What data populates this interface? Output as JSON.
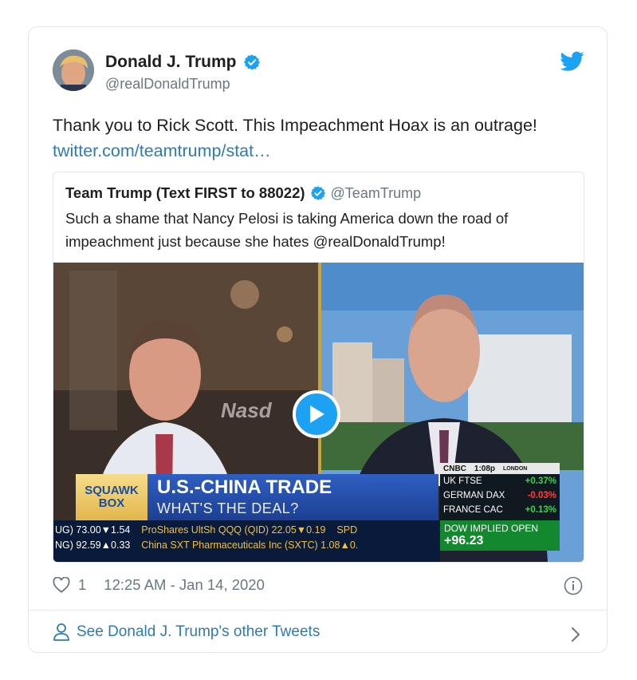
{
  "author": {
    "name": "Donald J. Trump",
    "handle": "@realDonaldTrump"
  },
  "tweet": {
    "text": "Thank you to Rick Scott. This Impeachment Hoax is an outrage!",
    "link": "twitter.com/teamtrump/stat…"
  },
  "quoted": {
    "name": "Team Trump (Text FIRST to 88022)",
    "handle": "@TeamTrump",
    "text": "Such a shame that Nancy Pelosi is taking America down the road of impeachment just because she hates @realDonaldTrump!"
  },
  "video": {
    "watermark": "Nasd",
    "show_line1": "SQUAWK",
    "show_line2": "BOX",
    "headline": "U.S.-CHINA TRADE",
    "subheadline": "WHAT'S THE DEAL?",
    "network": "CNBC",
    "time": "1:08p",
    "city": "LONDON",
    "markets": [
      {
        "label": "UK FTSE",
        "value": "+0.37%",
        "dir": "up"
      },
      {
        "label": "GERMAN DAX",
        "value": "-0.03%",
        "dir": "down"
      },
      {
        "label": "FRANCE CAC",
        "value": "+0.13%",
        "dir": "up"
      }
    ],
    "dow_label": "DOW IMPLIED OPEN",
    "dow_value": "+96.23",
    "ticker1_a": "UG) 73.00▼1.54",
    "ticker1_b": "ProShares UltSh QQQ (QID) 22.05▼0.19",
    "ticker1_c": "SPD",
    "ticker2_a": "NG) 92.59▲0.33",
    "ticker2_b": "China SXT Pharmaceuticals Inc (SXTC) 1.08▲0.",
    "colors": {
      "accent": "#1da1f2",
      "headline_bg": "#2f5fc2",
      "dow_bg": "#14882e"
    }
  },
  "meta": {
    "likes": "1",
    "timestamp": "12:25 AM - Jan 14, 2020"
  },
  "footer": {
    "link": "See Donald J. Trump's other Tweets"
  },
  "icons": [
    "verified-badge-icon",
    "twitter-bird-icon",
    "play-icon",
    "heart-icon",
    "info-icon",
    "person-icon",
    "chevron-right-icon"
  ]
}
